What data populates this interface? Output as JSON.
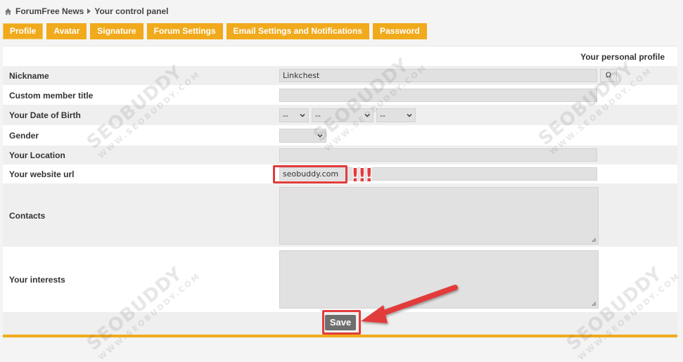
{
  "breadcrumb": {
    "forum": "ForumFree News",
    "page": "Your control panel"
  },
  "tabs": [
    {
      "label": "Profile",
      "active": true
    },
    {
      "label": "Avatar"
    },
    {
      "label": "Signature"
    },
    {
      "label": "Forum Settings"
    },
    {
      "label": "Email Settings and Notifications"
    },
    {
      "label": "Password"
    }
  ],
  "panel": {
    "title": "Your personal profile"
  },
  "form": {
    "nickname": {
      "label": "Nickname",
      "value": "Linkchest",
      "omega": "Ω"
    },
    "member_title": {
      "label": "Custom member title",
      "value": ""
    },
    "dob": {
      "label": "Your Date of Birth",
      "day": "--",
      "month": "--",
      "year": "--"
    },
    "gender": {
      "label": "Gender",
      "value": ""
    },
    "location": {
      "label": "Your Location",
      "value": ""
    },
    "website": {
      "label": "Your website url",
      "value": "seobuddy.com"
    },
    "contacts": {
      "label": "Contacts",
      "value": ""
    },
    "interests": {
      "label": "Your interests",
      "value": ""
    }
  },
  "annotation": {
    "exclaim": "!!!"
  },
  "save_label": "Save",
  "watermark": {
    "main": "SEOBUDDY",
    "sub": "WWW.SEOBUDDY.COM"
  },
  "colors": {
    "tab": "#f0aa1c",
    "highlight": "#e23b3b",
    "button": "#6e6e6e"
  }
}
